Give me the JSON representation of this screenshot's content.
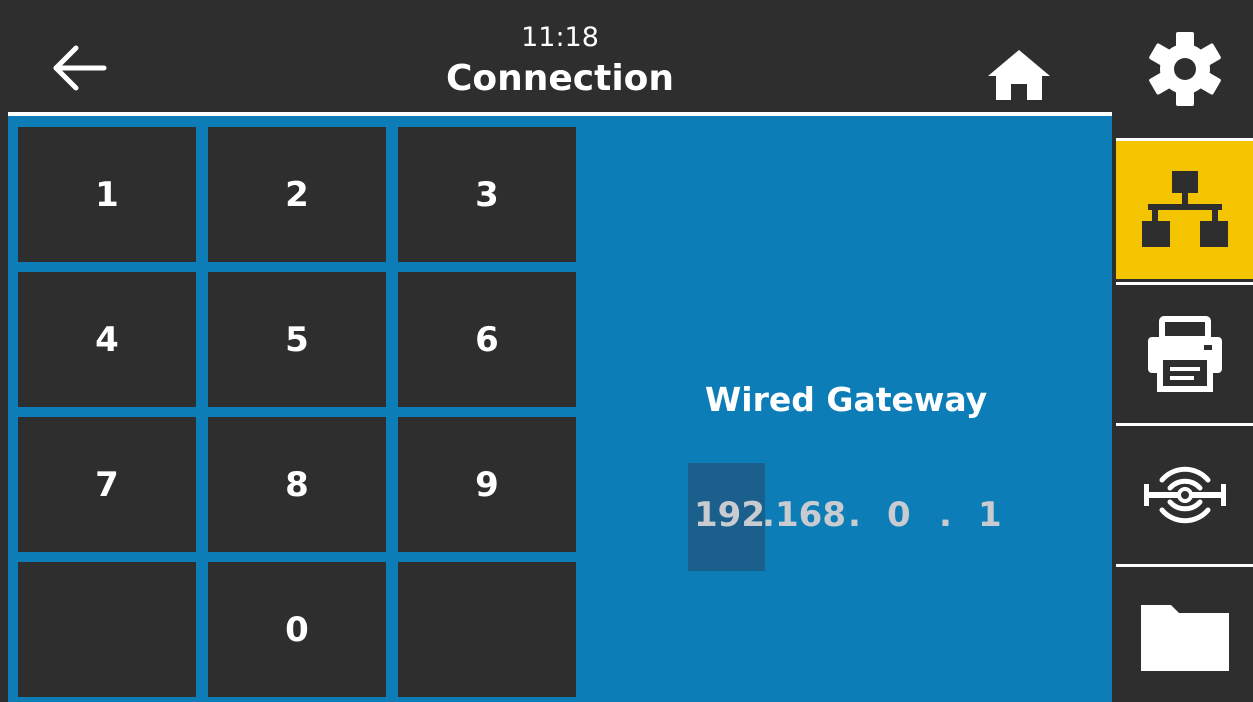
{
  "header": {
    "time": "11:18",
    "title": "Connection",
    "back_icon": "arrow-left-icon",
    "home_icon": "home-icon"
  },
  "keypad": {
    "keys": [
      "1",
      "2",
      "3",
      "4",
      "5",
      "6",
      "7",
      "8",
      "9",
      "",
      "0",
      ""
    ]
  },
  "field": {
    "label": "Wired Gateway",
    "octets": [
      "192",
      "168",
      "0",
      "1"
    ],
    "separator": ".",
    "selected_octet_index": 0
  },
  "sidebar": {
    "items": [
      {
        "name": "settings",
        "icon": "gear-icon",
        "active": false
      },
      {
        "name": "connection",
        "icon": "network-icon",
        "active": true
      },
      {
        "name": "print",
        "icon": "printer-icon",
        "active": false
      },
      {
        "name": "rfid",
        "icon": "rfid-icon",
        "active": false
      },
      {
        "name": "storage",
        "icon": "folder-icon",
        "active": false
      }
    ]
  },
  "colors": {
    "accent": "#f4c400",
    "background_blue": "#0d7db7",
    "tile": "#2e2e2e",
    "selection": "#1b5f8c"
  }
}
